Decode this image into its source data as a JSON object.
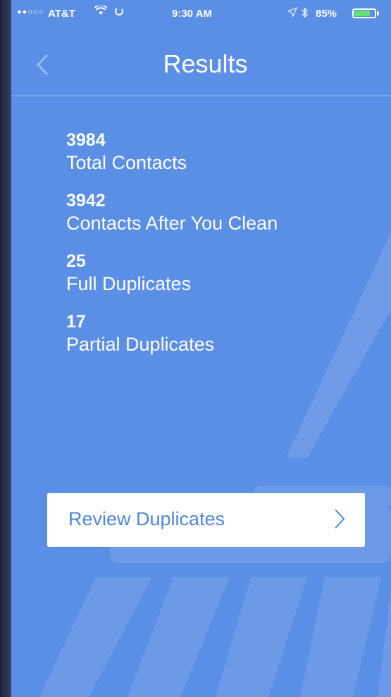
{
  "status_bar": {
    "signal": "●●○○○",
    "carrier": "AT&T",
    "time": "9:30 AM",
    "battery_percent": "85%",
    "battery_level": 0.85
  },
  "nav": {
    "title": "Results"
  },
  "stats": [
    {
      "value": "3984",
      "label": "Total Contacts"
    },
    {
      "value": "3942",
      "label": "Contacts After You Clean"
    },
    {
      "value": "25",
      "label": "Full Duplicates"
    },
    {
      "value": "17",
      "label": "Partial Duplicates"
    }
  ],
  "review_button": {
    "label": "Review Duplicates"
  },
  "colors": {
    "screen_bg": "#5b8fe6",
    "button_text": "#4f86e2",
    "battery_fill": "#5ee07a"
  },
  "icons": {
    "back": "chevron-left-icon",
    "review": "chevron-right-icon",
    "wifi": "wifi-icon",
    "location": "location-arrow-icon",
    "bluetooth": "bluetooth-icon"
  }
}
